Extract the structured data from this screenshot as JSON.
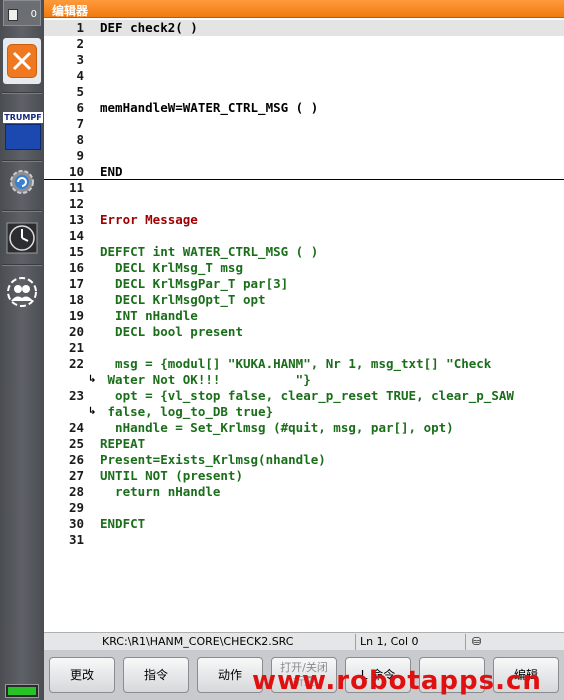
{
  "sidebar": {
    "counter": "0",
    "trumpf_label": "TRUMPF"
  },
  "editor": {
    "title": "编辑器",
    "lines": [
      {
        "n": "1",
        "text": "DEF check2( )",
        "color": "black",
        "current": true
      },
      {
        "n": "2",
        "text": "",
        "color": "black"
      },
      {
        "n": "3",
        "text": "",
        "color": "black"
      },
      {
        "n": "4",
        "text": "",
        "color": "black"
      },
      {
        "n": "5",
        "text": "",
        "color": "black"
      },
      {
        "n": "6",
        "text": "memHandleW=WATER_CTRL_MSG ( )",
        "color": "black"
      },
      {
        "n": "7",
        "text": "",
        "color": "black"
      },
      {
        "n": "8",
        "text": "",
        "color": "black"
      },
      {
        "n": "9",
        "text": "",
        "color": "black"
      },
      {
        "n": "10",
        "text": "END",
        "color": "black"
      },
      {
        "n": "11",
        "text": "",
        "color": "black"
      },
      {
        "n": "12",
        "text": "",
        "color": "black"
      },
      {
        "n": "13",
        "text": "Error Message",
        "color": "red"
      },
      {
        "n": "14",
        "text": "",
        "color": "black"
      },
      {
        "n": "15",
        "text": "DEFFCT int WATER_CTRL_MSG ( )",
        "color": "green"
      },
      {
        "n": "16",
        "text": "  DECL KrlMsg_T msg",
        "color": "green"
      },
      {
        "n": "17",
        "text": "  DECL KrlMsgPar_T par[3]",
        "color": "green"
      },
      {
        "n": "18",
        "text": "  DECL KrlMsgOpt_T opt",
        "color": "green"
      },
      {
        "n": "19",
        "text": "  INT nHandle",
        "color": "green"
      },
      {
        "n": "20",
        "text": "  DECL bool present",
        "color": "green"
      },
      {
        "n": "21",
        "text": "",
        "color": "green"
      },
      {
        "n": "22",
        "text": "  msg = {modul[] \"KUKA.HANM\", Nr 1, msg_txt[] \"Check",
        "color": "green"
      },
      {
        "n": "",
        "text": " Water Not OK!!!          \"}",
        "color": "green",
        "wrap": true
      },
      {
        "n": "23",
        "text": "  opt = {vl_stop false, clear_p_reset TRUE, clear_p_SAW",
        "color": "green"
      },
      {
        "n": "",
        "text": " false, log_to_DB true}",
        "color": "green",
        "wrap": true
      },
      {
        "n": "24",
        "text": "  nHandle = Set_Krlmsg (#quit, msg, par[], opt)",
        "color": "green"
      },
      {
        "n": "25",
        "text": "REPEAT",
        "color": "green"
      },
      {
        "n": "26",
        "text": "Present=Exists_Krlmsg(nhandle)",
        "color": "green"
      },
      {
        "n": "27",
        "text": "UNTIL NOT (present)",
        "color": "green"
      },
      {
        "n": "28",
        "text": "  return nHandle",
        "color": "green"
      },
      {
        "n": "29",
        "text": "",
        "color": "green"
      },
      {
        "n": "30",
        "text": "ENDFCT",
        "color": "green"
      },
      {
        "n": "31",
        "text": "",
        "color": "green"
      }
    ]
  },
  "status": {
    "path": "KRC:\\R1\\HANM_CORE\\CHECK2.SRC",
    "position": "Ln 1, Col 0"
  },
  "buttons": {
    "change": "更改",
    "command": "指令",
    "motion": "动作",
    "open_close": "打开/关闭",
    "fold": "折叠",
    "next_command": "L 命令",
    "blank": "",
    "edit": "编辑"
  },
  "watermark": "www.robotapps.cn",
  "colors": {
    "title_orange": "#f07a10",
    "code_green": "#1a6e1a",
    "code_red": "#a00000",
    "close_orange": "#f07820",
    "trumpf_blue": "#1b49b0"
  }
}
